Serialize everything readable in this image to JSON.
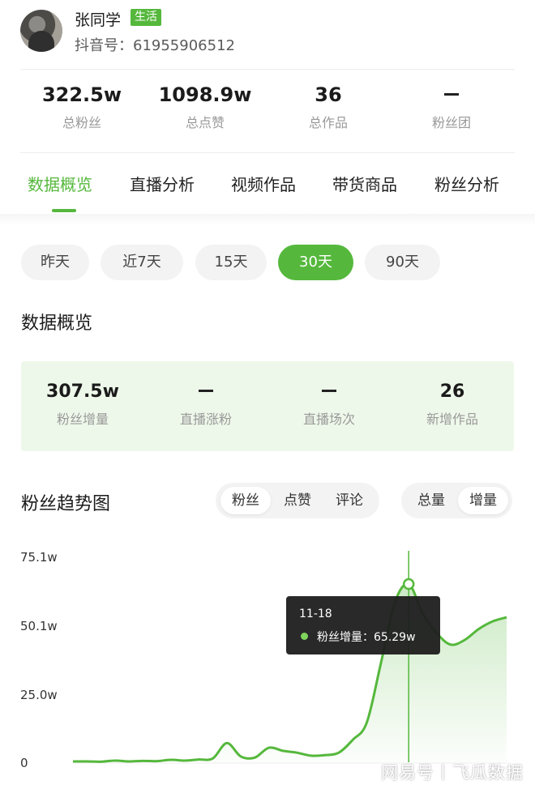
{
  "profile": {
    "name": "张同学",
    "tag": "生活",
    "account_id": "抖音号：61955906512"
  },
  "stats": [
    {
      "value": "322.5w",
      "label": "总粉丝"
    },
    {
      "value": "1098.9w",
      "label": "总点赞"
    },
    {
      "value": "36",
      "label": "总作品"
    },
    {
      "value": "",
      "label": "粉丝团"
    }
  ],
  "tabs": [
    "数据概览",
    "直播分析",
    "视频作品",
    "带货商品",
    "粉丝分析"
  ],
  "active_tab": 0,
  "periods": [
    "昨天",
    "近7天",
    "15天",
    "30天",
    "90天"
  ],
  "active_period": 3,
  "overview": {
    "title": "数据概览",
    "items": [
      {
        "value": "307.5w",
        "label": "粉丝增量"
      },
      {
        "value": "",
        "label": "直播涨粉"
      },
      {
        "value": "",
        "label": "直播场次"
      },
      {
        "value": "26",
        "label": "新增作品"
      }
    ]
  },
  "trend": {
    "title": "粉丝趋势图",
    "metric_options": [
      "粉丝",
      "点赞",
      "评论"
    ],
    "selected_metric": 0,
    "mode_options": [
      "总量",
      "增量"
    ],
    "selected_mode": 1,
    "tooltip": {
      "date": "11-18",
      "text": "粉丝增量：65.29w"
    }
  },
  "watermark": "网易号丨飞瓜数据",
  "colors": {
    "accent": "#55b83c",
    "panel": "#eef8ea"
  },
  "chart_data": {
    "type": "area",
    "title": "",
    "xlabel": "",
    "ylabel": "",
    "y_tick_labels": [
      "75.1w",
      "50.1w",
      "25.0w",
      "0"
    ],
    "ylim": [
      0,
      75.1
    ],
    "y_unit": "w",
    "highlight_index": 24,
    "series": [
      {
        "values": [
          0.3,
          0.3,
          0.2,
          0.6,
          0.3,
          0.5,
          0.4,
          0.9,
          0.6,
          1.0,
          1.4,
          7.0,
          2.1,
          1.7,
          5.3,
          4.2,
          3.5,
          2.4,
          2.6,
          3.5,
          8.2,
          14.5,
          36.0,
          58.4,
          65.29,
          54.5,
          47.3,
          43.1,
          44.8,
          48.8,
          51.6,
          53.1
        ]
      }
    ]
  }
}
